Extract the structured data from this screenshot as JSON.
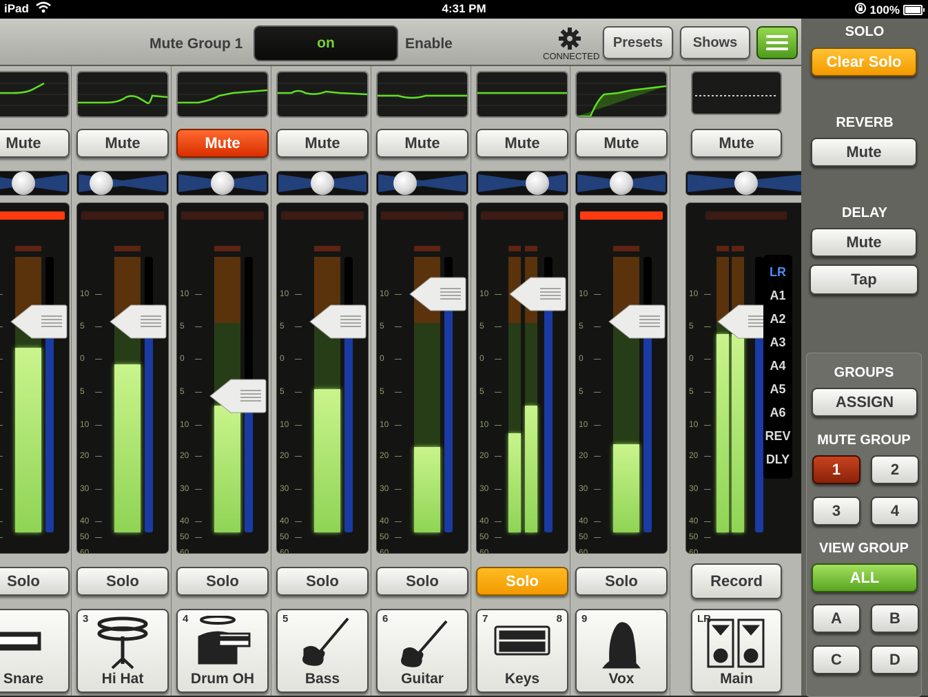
{
  "status_bar": {
    "device": "iPad",
    "time": "4:31 PM",
    "battery": "100%"
  },
  "top_bar": {
    "mute_group_label": "Mute Group 1",
    "toggle_value": "on",
    "enable_label": "Enable",
    "connection_status": "CONNECTED",
    "presets_label": "Presets",
    "shows_label": "Shows",
    "icons": [
      "gear-icon",
      "menu-icon"
    ]
  },
  "channels": [
    {
      "name": "Snare",
      "number": "",
      "icon": "snare-drum-icon",
      "mute": "Mute",
      "mute_active": false,
      "solo": "Solo",
      "solo_active": false,
      "clip": true,
      "pan": 0.5,
      "fader_db": "0",
      "meter_level": 0.67
    },
    {
      "name": "Hi Hat",
      "number": "3",
      "icon": "hi-hat-icon",
      "mute": "Mute",
      "mute_active": false,
      "solo": "Solo",
      "solo_active": false,
      "clip": false,
      "pan": 0.18,
      "fader_db": "0",
      "meter_level": 0.61
    },
    {
      "name": "Drum OH",
      "number": "4",
      "icon": "drum-kit-icon",
      "mute": "Mute",
      "mute_active": true,
      "solo": "Solo",
      "solo_active": false,
      "clip": false,
      "pan": 0.5,
      "fader_db": "-10",
      "meter_level": 0.46
    },
    {
      "name": "Bass",
      "number": "5",
      "icon": "bass-guitar-icon",
      "mute": "Mute",
      "mute_active": false,
      "solo": "Solo",
      "solo_active": false,
      "clip": false,
      "pan": 0.5,
      "fader_db": "0",
      "meter_level": 0.52
    },
    {
      "name": "Guitar",
      "number": "6",
      "icon": "electric-guitar-icon",
      "mute": "Mute",
      "mute_active": false,
      "solo": "Solo",
      "solo_active": false,
      "clip": false,
      "pan": 0.24,
      "fader_db": "+5",
      "meter_level": 0.31
    },
    {
      "name": "Keys",
      "number": "7",
      "number2": "8",
      "icon": "keyboard-icon",
      "mute": "Mute",
      "mute_active": false,
      "solo": "Solo",
      "solo_active": true,
      "clip": false,
      "pan": 0.72,
      "fader_db": "+5",
      "meter_level": 0.36
    },
    {
      "name": "Vox",
      "number": "9",
      "icon": "vocalist-icon",
      "mute": "Mute",
      "mute_active": false,
      "solo": "Solo",
      "solo_active": false,
      "clip": true,
      "pan": 0.5,
      "fader_db": "0",
      "meter_level": 0.32
    },
    {
      "name": "Main",
      "number": "LR",
      "icon": "speakers-icon",
      "mute": "Mute",
      "mute_active": false,
      "solo": "Record",
      "solo_active": false,
      "clip": false,
      "pan": 0.5,
      "fader_db": "0",
      "meter_level": 0.72
    }
  ],
  "scale_labels": [
    "10",
    "5",
    "0",
    "5",
    "10",
    "20",
    "30",
    "40",
    "50",
    "60",
    "∞"
  ],
  "bus_list": [
    "LR",
    "A1",
    "A2",
    "A3",
    "A4",
    "A5",
    "A6",
    "REV",
    "DLY"
  ],
  "sidebar": {
    "solo_heading": "SOLO",
    "clear_solo": "Clear Solo",
    "reverb_heading": "REVERB",
    "reverb_mute": "Mute",
    "delay_heading": "DELAY",
    "delay_mute": "Mute",
    "delay_tap": "Tap",
    "groups_heading": "GROUPS",
    "assign": "ASSIGN",
    "mute_group_heading": "MUTE GROUP",
    "mute_groups": [
      "1",
      "2",
      "3",
      "4"
    ],
    "view_group_heading": "VIEW GROUP",
    "view_all": "ALL",
    "view_groups": [
      "A",
      "B",
      "C",
      "D"
    ]
  },
  "colors": {
    "accent_green": "#76d13a",
    "mute_active": "#e8400b",
    "solo_active": "#f5a300",
    "meter": "#a8e46c",
    "track": "#1a3ba3"
  }
}
